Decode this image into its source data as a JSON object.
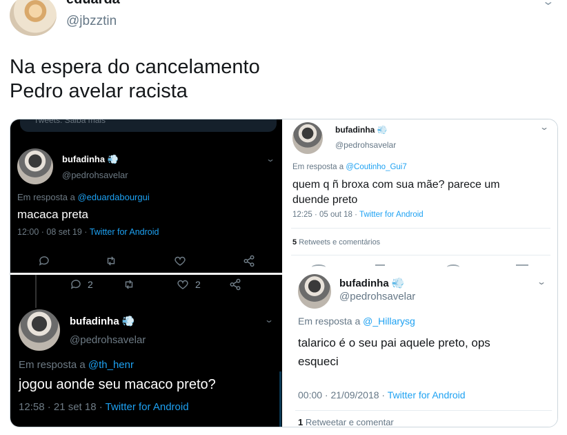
{
  "author": {
    "display_name": "eduarda",
    "handle": "@jbzztin"
  },
  "tweet": {
    "line1": "Na espera do cancelamento",
    "line2": "Pedro avelar racista"
  },
  "screenshots": {
    "top_left": {
      "top_fragment": "Tweets: Saiba mais",
      "name": "bufadinha",
      "handle": "@pedrohsavelar",
      "reply_prefix": "Em resposta a",
      "reply_to": "@eduardabourgui",
      "text": "macaca preta",
      "time": "12:00 · 08 set 19 ·",
      "source": "Twitter for Android"
    },
    "bottom_left": {
      "reply_count": "2",
      "like_count": "2",
      "name": "bufadinha",
      "handle": "@pedrohsavelar",
      "reply_prefix": "Em resposta a",
      "reply_to": "@th_henr",
      "text": "jogou aonde seu macaco preto?",
      "time": "12:58 · 21 set 18 ·",
      "source": "Twitter for Android"
    },
    "top_right": {
      "name": "bufadinha",
      "handle": "@pedrohsavelar",
      "reply_prefix": "Em resposta a",
      "reply_to": "@Coutinho_Gui7",
      "text_line1": "quem q ñ broxa com sua mãe? parece um",
      "text_line2": "duende preto",
      "time": "12:25 · 05 out 18 ·",
      "source": "Twitter for Android",
      "retweets_count": "5",
      "retweets_label": "Retweets e comentários"
    },
    "bottom_right": {
      "name": "bufadinha",
      "handle": "@pedrohsavelar",
      "reply_prefix": "Em resposta a",
      "reply_to": "@_Hillarysg",
      "text_line1": "talarico é o seu pai aquele preto, ops",
      "text_line2": "esqueci",
      "time": "00:00 · 21/09/2018 ·",
      "source": "Twitter for Android",
      "retweet_count": "1",
      "retweet_label": "Retweetar e comentar"
    }
  },
  "colors": {
    "link": "#1da1f2",
    "muted": "#8899a6",
    "dark_bg": "#000000"
  }
}
